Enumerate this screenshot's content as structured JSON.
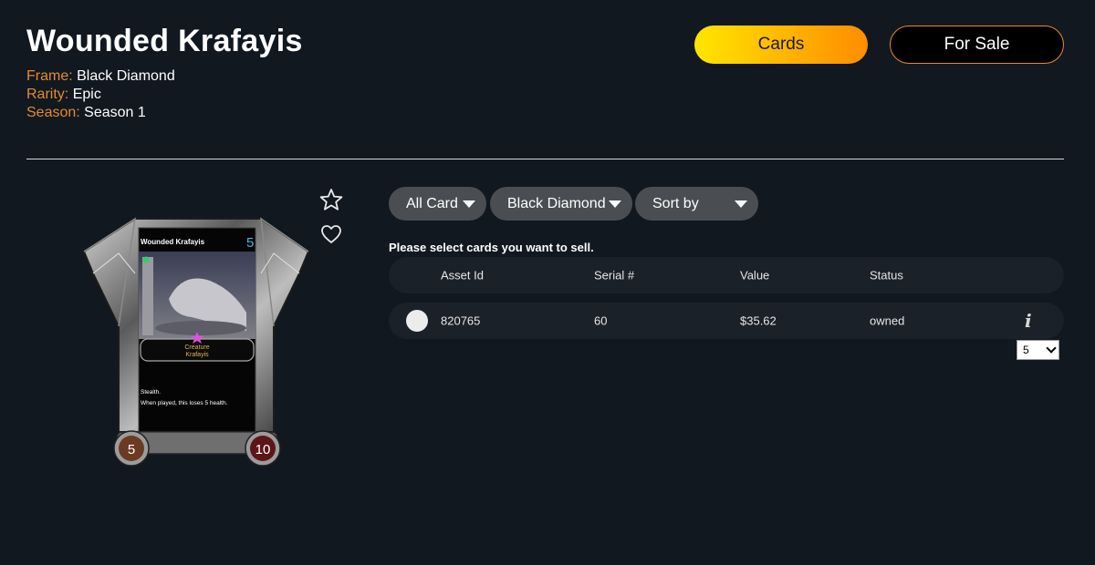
{
  "header": {
    "title": "Wounded Krafayis",
    "frame_label": "Frame:",
    "frame_value": "Black Diamond",
    "rarity_label": "Rarity:",
    "rarity_value": "Epic",
    "season_label": "Season:",
    "season_value": "Season 1"
  },
  "nav": {
    "cards_label": "Cards",
    "for_sale_label": "For Sale"
  },
  "card": {
    "name": "Wounded Krafayis",
    "cost": "5",
    "type": "Creature",
    "subtype": "Krafayis",
    "ability_1": "Stealth.",
    "ability_2": "When played, this loses 5 health.",
    "attack": "5",
    "health": "10"
  },
  "filters": {
    "type_label": "All Card",
    "frame_label": "Black Diamond",
    "sort_label": "Sort by"
  },
  "instruction": "Please select cards you want to sell.",
  "table": {
    "headers": [
      "Asset Id",
      "Serial #",
      "Value",
      "Status"
    ],
    "rows": [
      {
        "asset_id": "820765",
        "serial": "60",
        "value": "$35.62",
        "status": "owned"
      }
    ]
  },
  "page_size": {
    "selected": "5"
  },
  "icons": [
    "star-icon",
    "heart-icon",
    "info-icon",
    "caret-down-icon"
  ],
  "colors": {
    "accent": "#e58a2c",
    "cards_gradient_start": "#ffe600",
    "cards_gradient_end": "#ff8c00",
    "background": "#111820"
  }
}
